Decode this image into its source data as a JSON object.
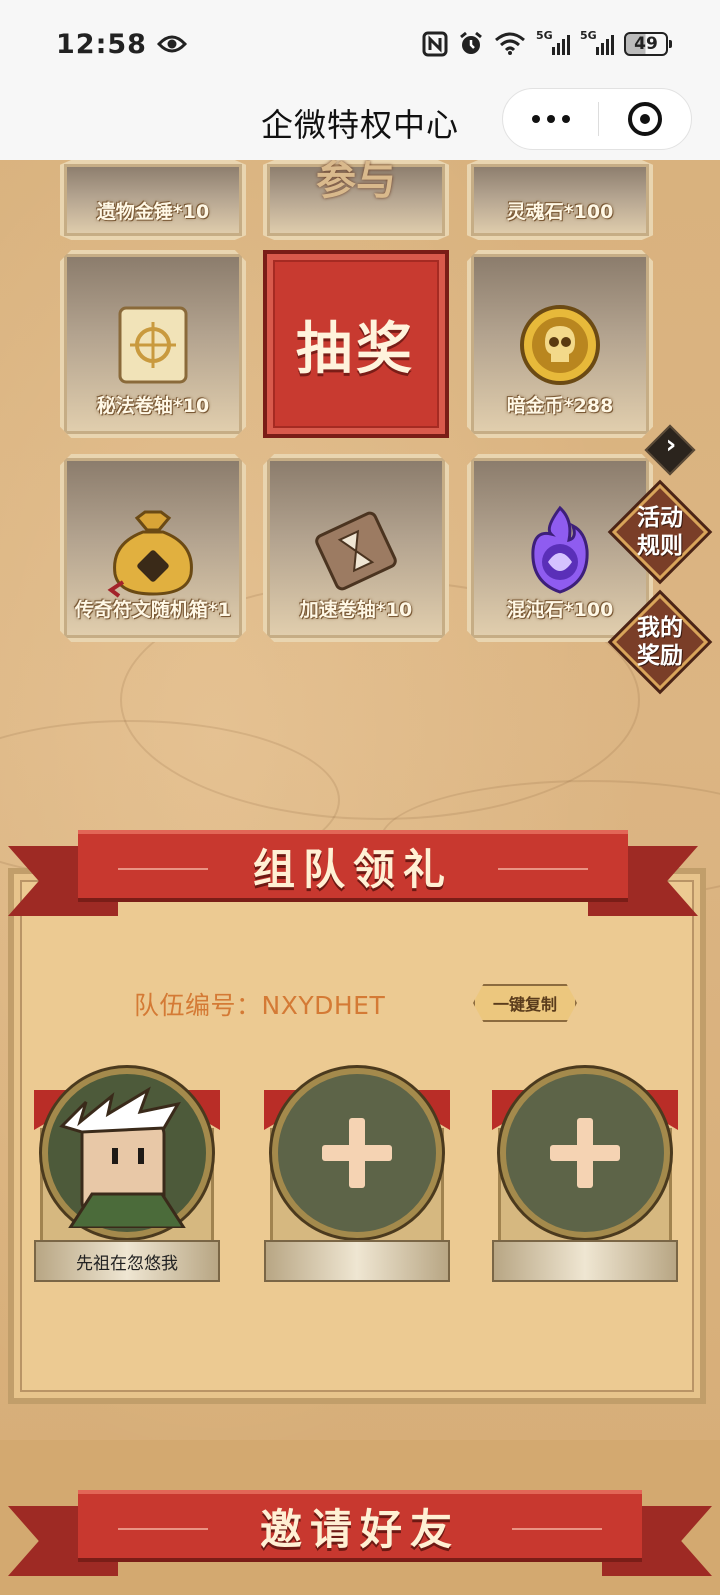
{
  "status_bar": {
    "time": "12:58",
    "icons": [
      "eye-icon",
      "nfc-icon",
      "alarm-icon",
      "wifi-icon",
      "signal-5g-icon",
      "signal-5g-icon"
    ],
    "network_1": "5G",
    "network_2": "5G",
    "battery": "49"
  },
  "title_bar": {
    "title": "企微特权中心",
    "more_icon": "more-dots-icon",
    "close_icon": "target-close-icon"
  },
  "prizes": {
    "top_row": [
      {
        "label": "遗物金锤*10",
        "icon": "gold-hammer-icon"
      },
      {
        "label": "参与",
        "icon": "stamp-icon"
      },
      {
        "label": "灵魂石*100",
        "icon": "red-gem-icon"
      }
    ],
    "middle_row": [
      {
        "label": "秘法卷轴*10",
        "icon": "scroll-icon"
      },
      {
        "label": "暗金币*288",
        "icon": "skull-coin-icon"
      }
    ],
    "bottom_row": [
      {
        "label": "传奇符文随机箱*1",
        "icon": "gold-bag-icon"
      },
      {
        "label": "加速卷轴*10",
        "icon": "hourglass-scroll-icon"
      },
      {
        "label": "混沌石*100",
        "icon": "purple-flame-icon"
      }
    ],
    "draw_label": "抽奖"
  },
  "side_buttons": {
    "rules": [
      "活动",
      "规则"
    ],
    "rewards": [
      "我的",
      "奖励"
    ]
  },
  "team": {
    "banner": "组队领礼",
    "id_label": "队伍编号：",
    "id_value": "NXYDHET",
    "copy_label": "一键复制",
    "members": [
      {
        "name": "先祖在忽悠我",
        "filled": true
      },
      {
        "name": "",
        "filled": false
      },
      {
        "name": "",
        "filled": false
      }
    ]
  },
  "invite": {
    "banner": "邀请好友"
  },
  "colors": {
    "banner_red": "#c8382f",
    "team_id": "#d47a35",
    "tile_label": "#fff8e6"
  }
}
